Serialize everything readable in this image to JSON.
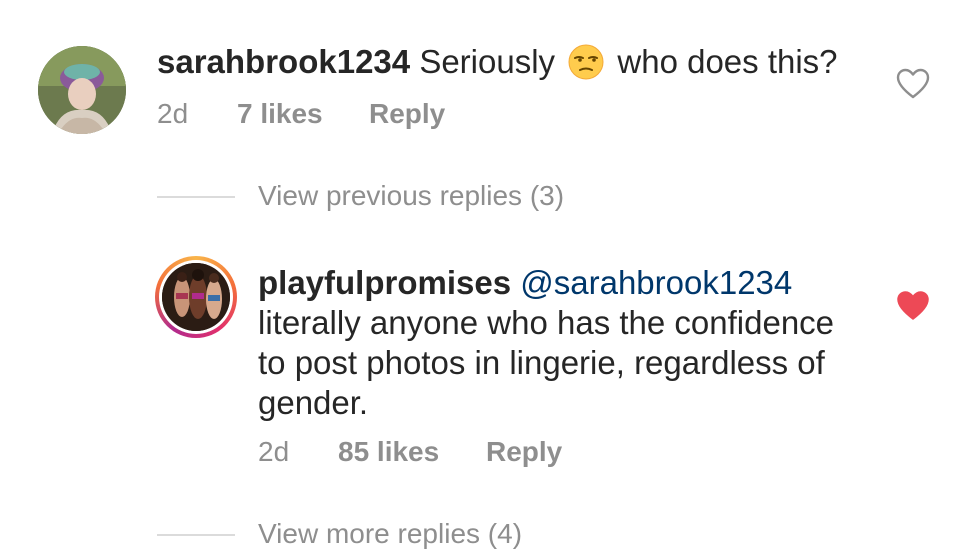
{
  "comment": {
    "username": "sarahbrook1234",
    "text_before_emoji": "Seriously",
    "emoji_name": "unamused-face-emoji",
    "text_after_emoji": "who does this?",
    "time": "2d",
    "likes": "7 likes",
    "reply_label": "Reply",
    "liked": false
  },
  "view_previous": "View previous replies (3)",
  "reply": {
    "username": "playfulpromises",
    "mention": "@sarahbrook1234",
    "text": "literally anyone who has the confidence to post photos in lingerie, regardless of gender.",
    "time": "2d",
    "likes": "85 likes",
    "reply_label": "Reply",
    "liked": true
  },
  "view_more": "View more replies (4)",
  "colors": {
    "text": "#262626",
    "secondary": "#8e8e8e",
    "heart_liked": "#ed4956",
    "mention": "#00376b"
  }
}
